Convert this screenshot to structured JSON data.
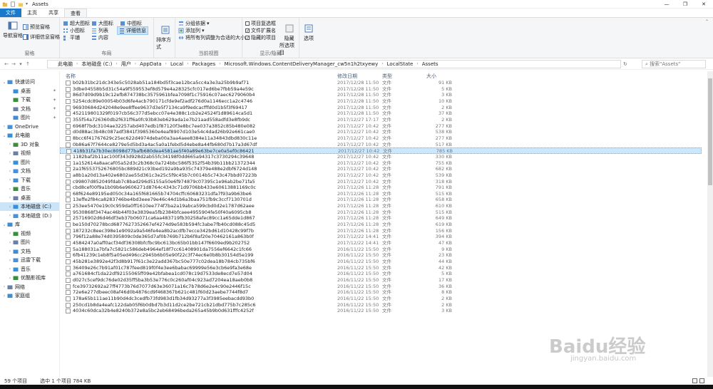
{
  "window": {
    "title": "Assets"
  },
  "tabs": [
    {
      "label": "文件"
    },
    {
      "label": "主页"
    },
    {
      "label": "共享"
    },
    {
      "label": "查看"
    }
  ],
  "ribbon": {
    "pane_group": {
      "label": "窗格",
      "nav_pane": "导航窗格",
      "preview": "预览窗格",
      "details": "详细信息窗格"
    },
    "layout_group": {
      "label": "布局",
      "xlarge": "超大图标",
      "large": "大图标",
      "medium": "中图标",
      "small": "小图标",
      "list": "列表",
      "detail": "详细信息",
      "tiles": "平铺",
      "content": "内容"
    },
    "sort": {
      "label": "排序方式"
    },
    "current_view_group": {
      "label": "当前视图",
      "group_by": "分组依据",
      "add_col": "添加列",
      "fit_cols": "将所有列调整为合适的大小"
    },
    "showhide_group": {
      "label": "显示/隐藏",
      "item_cb": "项目复选框",
      "ext": "文件扩展名",
      "hidden": "隐藏的项目",
      "hide_selected": "隐藏",
      "hide_selected2": "所选项目"
    },
    "options": {
      "label": "选项"
    }
  },
  "address": {
    "crumbs": [
      "此电脑",
      "本地磁盘 (C:)",
      "用户",
      "AppData",
      "Local",
      "Packages",
      "Microsoft.Windows.ContentDeliveryManager_cw5n1h2txyewy",
      "LocalState",
      "Assets"
    ],
    "search_placeholder": "搜索\"Assets\""
  },
  "nav": [
    {
      "label": "快速访问",
      "indent": 0,
      "arrow": "v"
    },
    {
      "label": "桌面",
      "indent": 1,
      "pin": true
    },
    {
      "label": "下载",
      "indent": 1,
      "pin": true
    },
    {
      "label": "文档",
      "indent": 1,
      "pin": true
    },
    {
      "label": "图片",
      "indent": 1,
      "pin": true
    },
    {
      "label": "OneDrive",
      "indent": 0,
      "arrow": ">"
    },
    {
      "label": "此电脑",
      "indent": 0,
      "arrow": "v"
    },
    {
      "label": "3D 对象",
      "indent": 1,
      "arrow": ">"
    },
    {
      "label": "视频",
      "indent": 1,
      "arrow": ">"
    },
    {
      "label": "图片",
      "indent": 1,
      "arrow": ">"
    },
    {
      "label": "文档",
      "indent": 1,
      "arrow": ">"
    },
    {
      "label": "下载",
      "indent": 1,
      "arrow": ">"
    },
    {
      "label": "音乐",
      "indent": 1,
      "arrow": ">"
    },
    {
      "label": "桌面",
      "indent": 1,
      "arrow": ">"
    },
    {
      "label": "本地磁盘 (C:)",
      "indent": 1,
      "arrow": ">",
      "selected": true
    },
    {
      "label": "本地磁盘 (D:)",
      "indent": 1,
      "arrow": ">"
    },
    {
      "label": "库",
      "indent": 0,
      "arrow": "v"
    },
    {
      "label": "视频",
      "indent": 1,
      "arrow": ">"
    },
    {
      "label": "图片",
      "indent": 1,
      "arrow": ">"
    },
    {
      "label": "文档",
      "indent": 1,
      "arrow": ">"
    },
    {
      "label": "迅雷下载",
      "indent": 1,
      "arrow": ">"
    },
    {
      "label": "音乐",
      "indent": 1,
      "arrow": ">"
    },
    {
      "label": "优酷影视库",
      "indent": 1,
      "arrow": ">"
    },
    {
      "label": "网络",
      "indent": 0,
      "arrow": ">"
    },
    {
      "label": "家庭组",
      "indent": 0,
      "arrow": ">"
    }
  ],
  "columns": {
    "name": "名称",
    "date": "修改日期",
    "type": "类型",
    "size": "大小"
  },
  "files": [
    {
      "name": "b02b31bc21dc343e5c5028ab51a184bd5f3cae12bca5cc4a3e3a25b9b9af71",
      "date": "2017/12/28 11:50",
      "type": "文件",
      "size": "91 KB"
    },
    {
      "name": "3dbe04558b5d31c54a9f559553ef8d579e4a28325cfc017ed6be7fbb59a4e59c",
      "date": "2017/12/28 11:50",
      "type": "文件",
      "size": "5 KB"
    },
    {
      "name": "86d7d09d9b19c12efb874738bc3575961bfea7098f1c75916c07aec6279060b4",
      "date": "2017/12/28 11:50",
      "type": "文件",
      "size": "3 KB"
    },
    {
      "name": "5254cdc89e00054b03d6fe4acb790171cfde9ef2adf276d0a1146ecc1a2c4746",
      "date": "2017/12/28 11:50",
      "type": "文件",
      "size": "10 KB"
    },
    {
      "name": "96930684d242048e9ee8ffee9637d3e5f7134ca9f9edcacfffd0d1b5f3f69417",
      "date": "2017/12/28 11:50",
      "type": "文件",
      "size": "2 KB"
    },
    {
      "name": "452119801329f0197cb56c377d5ebcc07e4e388c1cb2e24524f1d89614ca5d1",
      "date": "2017/12/28 11:50",
      "type": "文件",
      "size": "37 KB"
    },
    {
      "name": "355f54a726360db2f631ff6a0fc93b83eb629ada1e7b21aad558adfd3e8fb9dc",
      "date": "2017/12/27 17:17",
      "type": "文件",
      "size": "2 KB"
    },
    {
      "name": "6968f7bdc3104ae32257abd407edb1f87120f3e8bc7ee037a3852c85b480e082",
      "date": "2017/12/27 10:42",
      "type": "文件",
      "size": "277 KB"
    },
    {
      "name": "d0d88ac3b48c087adf3841f3985360e4eaf8907d103e54c4dad26b92e661cae0",
      "date": "2017/12/27 10:42",
      "type": "文件",
      "size": "538 KB"
    },
    {
      "name": "8bcc6f41767629c25ec622d4974deba00a3aa4aee8384e11a34843dbd830c11e",
      "date": "2017/12/27 10:42",
      "type": "文件",
      "size": "277 KB"
    },
    {
      "name": "0b86a67f7644ce8279e5d5bd3a4ac5a0a1febd5d4ebe8a44fb680d7b17a3d67df",
      "date": "2017/12/27 10:42",
      "type": "文件",
      "size": "517 KB"
    },
    {
      "name": "418b31fa7b30ec8098d77bafb680dea4581ae5f40a89e63be7ce0a5ef0c86421",
      "date": "2017/12/27 10:42",
      "type": "文件",
      "size": "785 KB",
      "selected": true
    },
    {
      "name": "1182baf2b11ac100f343d928d2ab55fc34198f0dd665a94317c3730294c39648",
      "date": "2017/12/27 10:42",
      "type": "文件",
      "size": "330 KB"
    },
    {
      "name": "1a152614a8aacaf05a52d3c2b368c0a724bbc586f5352f54b39b11bb21372344",
      "date": "2017/12/27 10:42",
      "type": "文件",
      "size": "755 KB"
    },
    {
      "name": "2a1f6553752676805bc889d21c93bed192a9ba935c74379e488e2dbf6724d148",
      "date": "2017/12/27 10:42",
      "type": "文件",
      "size": "682 KB"
    },
    {
      "name": "a8b1a20d13a402e6802ae55d361c3e25c5f9c45b7c0014b5c743c47bbd07223b",
      "date": "2017/12/27 10:42",
      "type": "文件",
      "size": "539 KB"
    },
    {
      "name": "c99807d852049fdab7c8bad296d5155a50e6f974879c07395c1e96ab2be71fa5",
      "date": "2017/12/27 10:42",
      "type": "文件",
      "size": "318 KB"
    },
    {
      "name": "cbd8cef00f9a1b09b6e9606271d8764c4343c71d9706bb433e60613881169c0c",
      "date": "2017/12/26 11:28",
      "type": "文件",
      "size": "791 KB"
    },
    {
      "name": "68f624e89195ed050c34a165f681665b74704cffc60683231dfa7f93a9b63be6",
      "date": "2017/12/26 11:28",
      "type": "文件",
      "size": "515 KB"
    },
    {
      "name": "13effe2f84ca8283746be4bd3eee79e46c44d1b6a3baa751fb9c3ccf7130701d",
      "date": "2017/12/26 11:28",
      "type": "文件",
      "size": "658 KB"
    },
    {
      "name": "253ee5470e19c0c959da0ff1610ee774f7ba2a19abca599cbd0d2e1787d62aee",
      "date": "2017/12/26 11:28",
      "type": "文件",
      "size": "610 KB"
    },
    {
      "name": "9530868f3474ac46b44f03e3839ea5fb2384bfcaee4955904fe50f40a6095cb8",
      "date": "2017/12/26 11:28",
      "type": "文件",
      "size": "515 KB"
    },
    {
      "name": "25716902d6d46df3eb37b06071ca6aa483719fb30258afec89cc1a65dde1d867",
      "date": "2017/12/26 11:28",
      "type": "文件",
      "size": "649 KB"
    },
    {
      "name": "be150d70278bcd6877627352667ef4274d9e583b594fc3abe7fb40cd088c45d5",
      "date": "2017/12/26 11:28",
      "type": "文件",
      "size": "619 KB"
    },
    {
      "name": "187232c8eec398e1e9092a9a546fe4ea8b2acdfb7ecce342bd61d10428c99f7b",
      "date": "2017/12/26 11:28",
      "type": "文件",
      "size": "156 KB"
    },
    {
      "name": "796f12a88e74d0395809c0de365d7af0b769b712b6f8af20e70462161a863b0f",
      "date": "2017/12/22 14:41",
      "type": "文件",
      "size": "394 KB"
    },
    {
      "name": "4584247a0aff0acf34df36308bfcfbc9bc613bc65b01bb147f6609ed9b202752",
      "date": "2017/12/22 14:41",
      "type": "文件",
      "size": "47 KB"
    },
    {
      "name": "5a188031a7bfa7c5821c586deb4964ef18f7cc61408901da7556ef6642c1fc66",
      "date": "2016/11/22 15:50",
      "type": "文件",
      "size": "9 KB"
    },
    {
      "name": "6fb41239c1eb8f5a05ed496cc2945b6b05e90f22c3f74ec6e0b8b30154d5e199",
      "date": "2016/11/22 15:50",
      "type": "文件",
      "size": "23 KB"
    },
    {
      "name": "45b281e3892e42f3d8b917f61c3e22add367bc50e777c02dea18b784cb735bf6",
      "date": "2016/11/22 15:50",
      "type": "文件",
      "size": "44 KB"
    },
    {
      "name": "36409e26c7b91af01c787feed819f0f4e3ee6babac69999e56e3cb6e9fa3e68e",
      "date": "2016/11/22 15:50",
      "type": "文件",
      "size": "42 KB"
    },
    {
      "name": "a761684cf1da22df92155065ff09e42bfabea1cd078c19d7533de8ecd7e57d04",
      "date": "2016/11/22 15:50",
      "type": "文件",
      "size": "5 KB"
    },
    {
      "name": "d027c5cef9dc76de02d35ff5ba3b53e776c0c260af04c923ad7204ea18aeb0b8",
      "date": "2016/11/22 15:50",
      "type": "文件",
      "size": "17 KB"
    },
    {
      "name": "fce39732692a27ff4773b76d7077d63e36071a16c7b78d6e2e4c90e2446f15c",
      "date": "2016/11/22 15:50",
      "type": "文件",
      "size": "36 KB"
    },
    {
      "name": "72e6e277dbeec08af46d0b4876cd9f468367b621c481f60d23aebe7744f8d7",
      "date": "2016/11/22 15:50",
      "type": "文件",
      "size": "8 KB"
    },
    {
      "name": "178a65b111ae11b90d4dc3cedfb73fd983d1fb34d93277a3f3985eebacdd93b0",
      "date": "2016/11/22 15:50",
      "type": "文件",
      "size": "2 KB"
    },
    {
      "name": "250cd1b8da4eafc122dab05f6b0dbd7b3d11d2ce2be721cb21dbd775b7c285c6",
      "date": "2016/11/22 15:50",
      "type": "文件",
      "size": "2 KB"
    },
    {
      "name": "4034c60dca32b4e8240b372e8a5bc2eb68496beda265a45b9b0d631fffc4252f",
      "date": "2016/11/22 15:50",
      "type": "文件",
      "size": "3 KB"
    }
  ],
  "status": {
    "count": "59 个项目",
    "selected": "选中 1 个项目  784 KB"
  },
  "watermark": {
    "brand": "Baidu经验",
    "url": "jingyan.baidu.com"
  },
  "colors": {
    "accent": "#1979ca",
    "selection": "#cce8ff"
  }
}
